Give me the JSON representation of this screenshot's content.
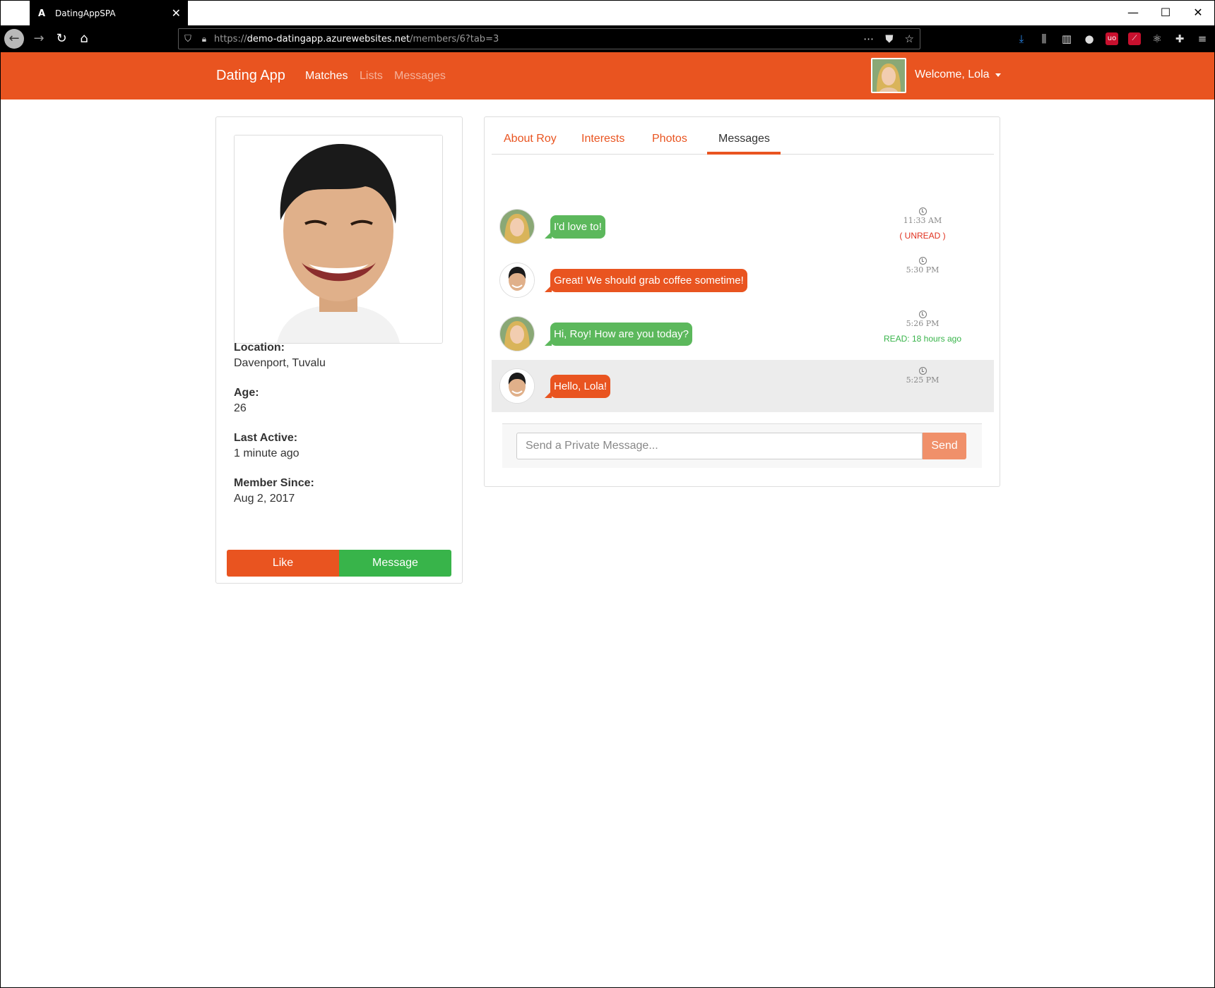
{
  "browser": {
    "tab_title": "DatingAppSPA",
    "url_scheme": "https://",
    "url_host": "demo-datingapp.azurewebsites.net",
    "url_path": "/members/6?tab=3"
  },
  "nav": {
    "brand": "Dating App",
    "links": [
      "Matches",
      "Lists",
      "Messages"
    ],
    "welcome": "Welcome, Lola"
  },
  "profile": {
    "location_label": "Location:",
    "location": "Davenport, Tuvalu",
    "age_label": "Age:",
    "age": "26",
    "last_active_label": "Last Active:",
    "last_active": "1 minute ago",
    "member_since_label": "Member Since:",
    "member_since": "Aug 2, 2017",
    "like_button": "Like",
    "message_button": "Message"
  },
  "tabs": [
    "About Roy",
    "Interests",
    "Photos",
    "Messages"
  ],
  "messages": [
    {
      "sender": "Lola",
      "text": "I'd love to!",
      "time": "11:33 AM",
      "status": "( UNREAD )"
    },
    {
      "sender": "Roy",
      "text": "Great! We should grab coffee sometime!",
      "time": "5:30 PM",
      "status": ""
    },
    {
      "sender": "Lola",
      "text": "Hi, Roy! How are you today?",
      "time": "5:26 PM",
      "status": "READ: 18 hours ago"
    },
    {
      "sender": "Roy",
      "text": "Hello, Lola!",
      "time": "5:25 PM",
      "status": ""
    }
  ],
  "compose": {
    "placeholder": "Send a Private Message...",
    "send_button": "Send"
  },
  "colors": {
    "brand": "#e95420",
    "success": "#38b44a",
    "unread": "#e0301e"
  }
}
